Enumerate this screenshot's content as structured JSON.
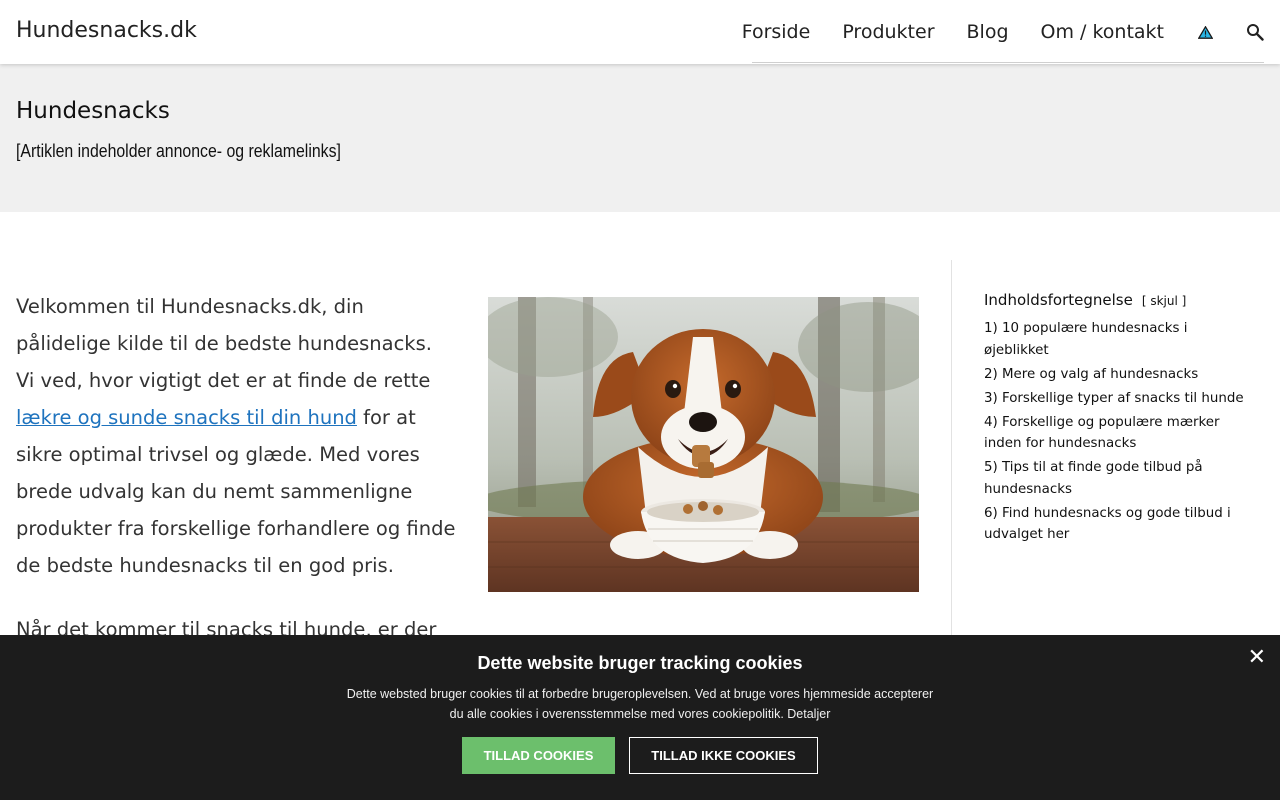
{
  "header": {
    "logo": "Hundesnacks.dk",
    "nav": [
      "Forside",
      "Produkter",
      "Blog",
      "Om / kontakt"
    ],
    "icons": [
      "warning-triangle-icon",
      "search-icon"
    ]
  },
  "page": {
    "title": "Hundesnacks",
    "ad_note": "[Artiklen indeholder annonce- og reklamelinks]"
  },
  "main": {
    "intro_before": "Velkommen til Hundesnacks.dk, din pålidelige kilde til de bedste hundesnacks. Vi ved, hvor vigtigt det er at finde de rette ",
    "intro_link": "lækre og sunde snacks til din hund",
    "intro_after": " for at sikre optimal trivsel og glæde. Med vores brede udvalg kan du nemt sammenligne produkter fra forskellige forhandlere og finde de bedste hundesnacks til en god pris.",
    "second_para": "Når det kommer til snacks til hunde, er der",
    "image": "dog-eating-snack-photo"
  },
  "toc": {
    "title": "Indholdsfortegnelse",
    "toggle": "[ skjul ]",
    "items": [
      "1) 10 populære hundesnacks i øjeblikket",
      "2) Mere og valg af hundesnacks",
      "3) Forskellige typer af snacks til hunde",
      "4) Forskellige og populære mærker inden for hundesnacks",
      "5) Tips til at finde gode tilbud på hundesnacks",
      "6) Find hundesnacks og gode tilbud i udvalget her"
    ]
  },
  "cookie": {
    "title": "Dette website bruger tracking cookies",
    "text": "Dette websted bruger cookies til at forbedre brugeroplevelsen. Ved at bruge vores hjemmeside accepterer du alle cookies i overensstemmelse med vores cookiepolitik. Detaljer",
    "allow": "TILLAD COOKIES",
    "deny": "TILLAD IKKE COOKIES",
    "close": "✕"
  },
  "colors": {
    "link": "#1e73be",
    "cookie_bg": "#1c1c1c",
    "allow_button": "#6cbf6c",
    "title_band": "#f0f0f0"
  }
}
